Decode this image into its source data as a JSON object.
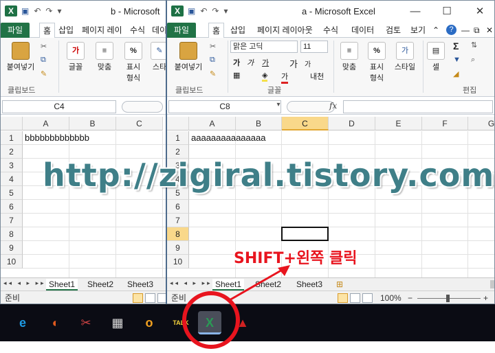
{
  "colors": {
    "excel_green": "#217346",
    "selection": "#f9d88a",
    "annotation_red": "#e8141e",
    "watermark": "#3f7f88"
  },
  "window_b": {
    "title": "b  -  Microsoft",
    "tabs": {
      "file": "파일",
      "home": "홈",
      "insert": "삽입",
      "page_layout": "페이지 레이",
      "formulas": "수식",
      "data": "데이"
    },
    "ribbon": {
      "paste": "붙여넣기",
      "clipboard_group": "클립보드",
      "font": "글꼴",
      "align": "맞춤",
      "number_line1": "표시",
      "number_line2": "형식",
      "style": "스타",
      "font_glyph": "가",
      "number_glyph": "%"
    },
    "name_box": "C4",
    "columns": [
      "A",
      "B",
      "C"
    ],
    "rows": [
      "1",
      "2",
      "3",
      "4",
      "5",
      "6",
      "7",
      "8",
      "9",
      "10"
    ],
    "cell_a1": "bbbbbbbbbbbbb",
    "sheet_nav": "◂◂ ◂ ▸ ▸▸",
    "sheets": [
      "Sheet1",
      "Sheet2",
      "Sheet3"
    ],
    "status": "준비"
  },
  "window_a": {
    "title": "a  -  Microsoft Excel",
    "tabs": {
      "file": "파일",
      "home": "홈",
      "insert": "삽입",
      "page_layout": "페이지 레이아웃",
      "formulas": "수식",
      "data": "데이터",
      "review": "검토",
      "view": "보기"
    },
    "ribbon": {
      "paste": "붙여넣기",
      "clipboard_group": "클립보드",
      "font_group": "글꼴",
      "font_name": "맑은 고딕",
      "font_size": "11",
      "bold": "가",
      "italic": "가",
      "underline": "가",
      "grow": "가",
      "shrink": "가",
      "font_color_glyph": "가",
      "phonetic": "내천",
      "align": "맞춤",
      "number_line1": "표시",
      "number_line2": "형식",
      "style": "스타일",
      "cells": "셀",
      "editing_group": "편집",
      "number_glyph": "%",
      "style_glyph": "가",
      "sigma": "Σ"
    },
    "name_box": "C8",
    "fx": "fx",
    "columns": [
      "A",
      "B",
      "C",
      "D",
      "E",
      "F",
      "G"
    ],
    "rows": [
      "1",
      "2",
      "3",
      "4",
      "5",
      "6",
      "7",
      "8",
      "9",
      "10"
    ],
    "cell_a1": "aaaaaaaaaaaaaaa",
    "sheet_nav": "◂◂ ◂ ▸ ▸▸",
    "sheets": [
      "Sheet1",
      "Sheet2",
      "Sheet3"
    ],
    "status": "준비",
    "zoom": "100%",
    "zoom_minus": "−",
    "zoom_plus": "+"
  },
  "window_controls": {
    "minimize": "—",
    "maximize": "☐",
    "close": "✕",
    "help": "?",
    "dropdown": "▾",
    "x_small": "✕"
  },
  "taskbar": {
    "apps": [
      {
        "icon": "internet-explorer-icon",
        "glyph": "e",
        "color": "#1e9be4"
      },
      {
        "icon": "media-player-icon",
        "glyph": "◐",
        "color": "#e05a1e"
      },
      {
        "icon": "paint-icon",
        "glyph": "✂",
        "color": "#d04444"
      },
      {
        "icon": "calculator-icon",
        "glyph": "▦",
        "color": "#dddddd"
      },
      {
        "icon": "outlook-icon",
        "glyph": "o",
        "color": "#f0a020"
      },
      {
        "icon": "kakaotalk-icon",
        "glyph": "TALK",
        "color": "#f7d43c"
      },
      {
        "icon": "excel-icon",
        "glyph": "X",
        "color": "#2a9a55"
      },
      {
        "icon": "pdf-icon",
        "glyph": "▲",
        "color": "#d12222"
      }
    ]
  },
  "overlay": {
    "watermark": "http://zigiral.tistory.com",
    "hint": "SHIFT+왼쪽 클릭"
  }
}
